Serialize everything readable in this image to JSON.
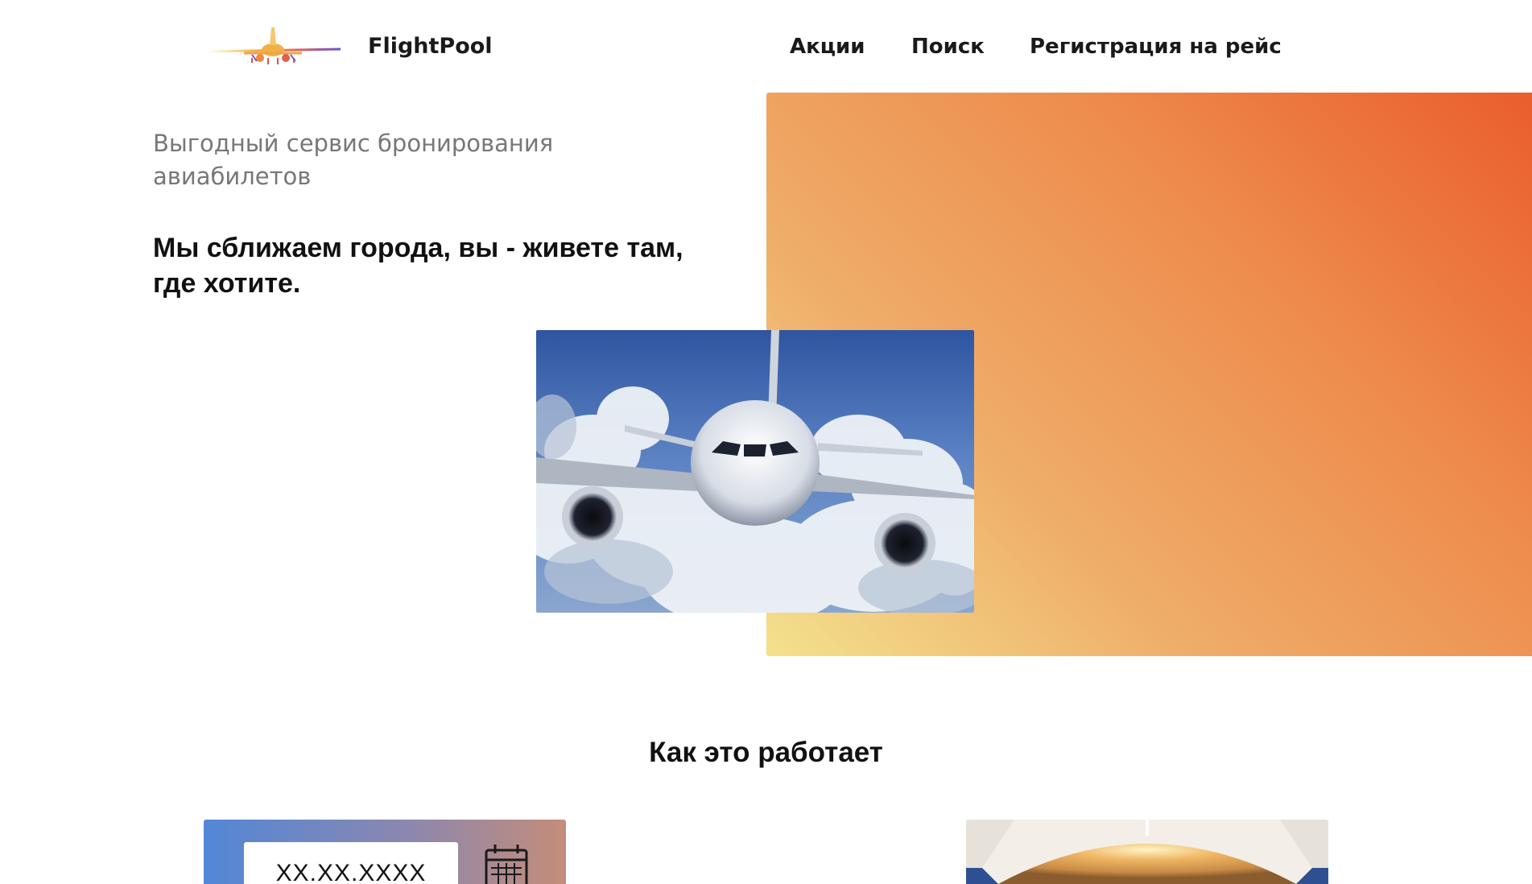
{
  "header": {
    "brand": "FlightPool",
    "logo": "airplane-logo",
    "nav": [
      "Акции",
      "Поиск",
      "Регистрация на рейс"
    ]
  },
  "hero": {
    "subtitle": "Выгодный сервис бронирования авиабилетов",
    "title": "Мы сближаем города, вы - живете там, где хотите.",
    "image": "airplane-in-clouds-photo",
    "gradient_colors": [
      "#f3e18e",
      "#efad6a",
      "#ee8d4d",
      "#ea5e2c"
    ]
  },
  "how_it_works": {
    "title": "Как это работает",
    "date_placeholder": "XX.XX.XXXX",
    "calendar_icon": "calendar-icon",
    "cabin_image": "airplane-cabin-photo"
  }
}
